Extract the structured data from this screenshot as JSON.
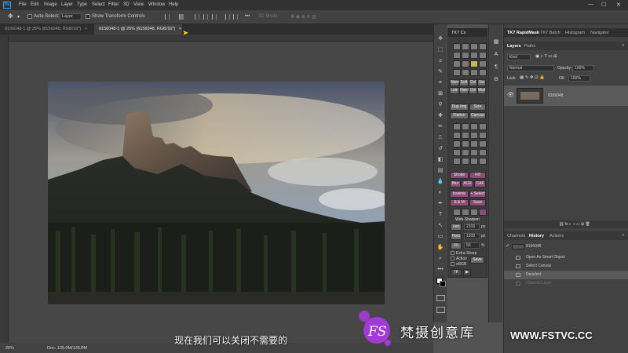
{
  "app": {
    "logo": "Ps"
  },
  "menu": [
    "File",
    "Edit",
    "Image",
    "Layer",
    "Type",
    "Select",
    "Filter",
    "3D",
    "View",
    "Window",
    "Help"
  ],
  "window_controls": {
    "minimize": "—",
    "maximize": "☐",
    "close": "✕"
  },
  "options_bar": {
    "auto_select_label": "Auto-Select:",
    "auto_select_value": "Layer",
    "transform_label": "Show Transform Controls",
    "mode_3d": "3D Mode:",
    "more": "•••"
  },
  "tabs": [
    {
      "label": "8156048-1 @ 25% (8156048, RGB/16*)",
      "close": "×"
    },
    {
      "label": "8156048-1 @ 25% (8156048, RGB/16*)",
      "close": "×"
    }
  ],
  "status": {
    "zoom": "25%",
    "doc": "Doc: 135.0M/135.0M"
  },
  "tk7": {
    "title": "TK7 Cx",
    "row_labels_1": [
      "Norm",
      "Soft",
      "Col",
      "Sw"
    ],
    "row_labels_2": [
      "Lum",
      "Hard",
      "Ctrl",
      "Mult"
    ],
    "dup_img": "Dup img",
    "size": "Size",
    "flatten": "Flatten",
    "canvas": "Canvas",
    "stroke": "Stroke",
    "fill": "Fill",
    "blur": "Blur",
    "acr": "ACR",
    "caf": "CAF",
    "inverse": "Inverse",
    "select": "+ Select",
    "sm": "S & M",
    "save": "Save",
    "web_sharpen": "Web-Sharpen",
    "vert": "Vert",
    "vert_value": "2100",
    "horz": "Horz",
    "horz_value": "1200",
    "px1": "px",
    "px2": "px",
    "fit": "Fit",
    "fit_value": "50",
    "pct": "%",
    "extra_sharp": "Extra Sharp",
    "action": "Action",
    "srgb": "sRGB",
    "save2": "Save",
    "tk": "TK",
    "arrow": "▶"
  },
  "panel_tabs_top": [
    "TK7 RapidMask",
    "TK7 Batch",
    "Histogram",
    "Navigator"
  ],
  "layers_panel": {
    "tabs": [
      "Layers",
      "Paths"
    ],
    "kind": "Kind",
    "blend": "Normal",
    "opacity_label": "Opacity:",
    "opacity_value": "100%",
    "lock_label": "Lock:",
    "fill_label": "Fill:",
    "fill_value": "100%",
    "layer_name": "8156048"
  },
  "history_panel": {
    "tabs": [
      "Channels",
      "History",
      "Actions"
    ],
    "items": [
      "8156048",
      "Open As Smart Object",
      "Select Canvas",
      "Deselect",
      "Channel Layer"
    ]
  },
  "subtitle": "现在我们可以关闭不需要的",
  "watermark": {
    "logo": "FS",
    "name": "梵摄创意库",
    "url": "WWW.FSTVC.CC"
  },
  "colors": {
    "accent": "#31a8ff",
    "tk7_pink": "#8a4d78",
    "watermark_purple": "#a23bd6"
  },
  "icons": [
    "move-icon",
    "marquee-icon",
    "lasso-icon",
    "quick-select-icon",
    "crop-icon",
    "frame-icon",
    "eyedropper-icon",
    "healing-icon",
    "brush-icon",
    "stamp-icon",
    "history-brush-icon",
    "eraser-icon",
    "gradient-icon",
    "blur-icon",
    "dodge-icon",
    "pen-icon",
    "type-icon",
    "path-select-icon",
    "rectangle-icon",
    "hand-icon",
    "zoom-icon",
    "more-tools-icon"
  ],
  "tool_glyphs": [
    "✥",
    "⬚",
    "ↄ",
    "✎",
    "⌗",
    "⊠",
    "⚲",
    "✚",
    "✏",
    "⎍",
    "↺",
    "◧",
    "▤",
    "💧",
    "◐",
    "✒",
    "T",
    "↖",
    "▭",
    "✋",
    "⌕",
    "•••"
  ]
}
